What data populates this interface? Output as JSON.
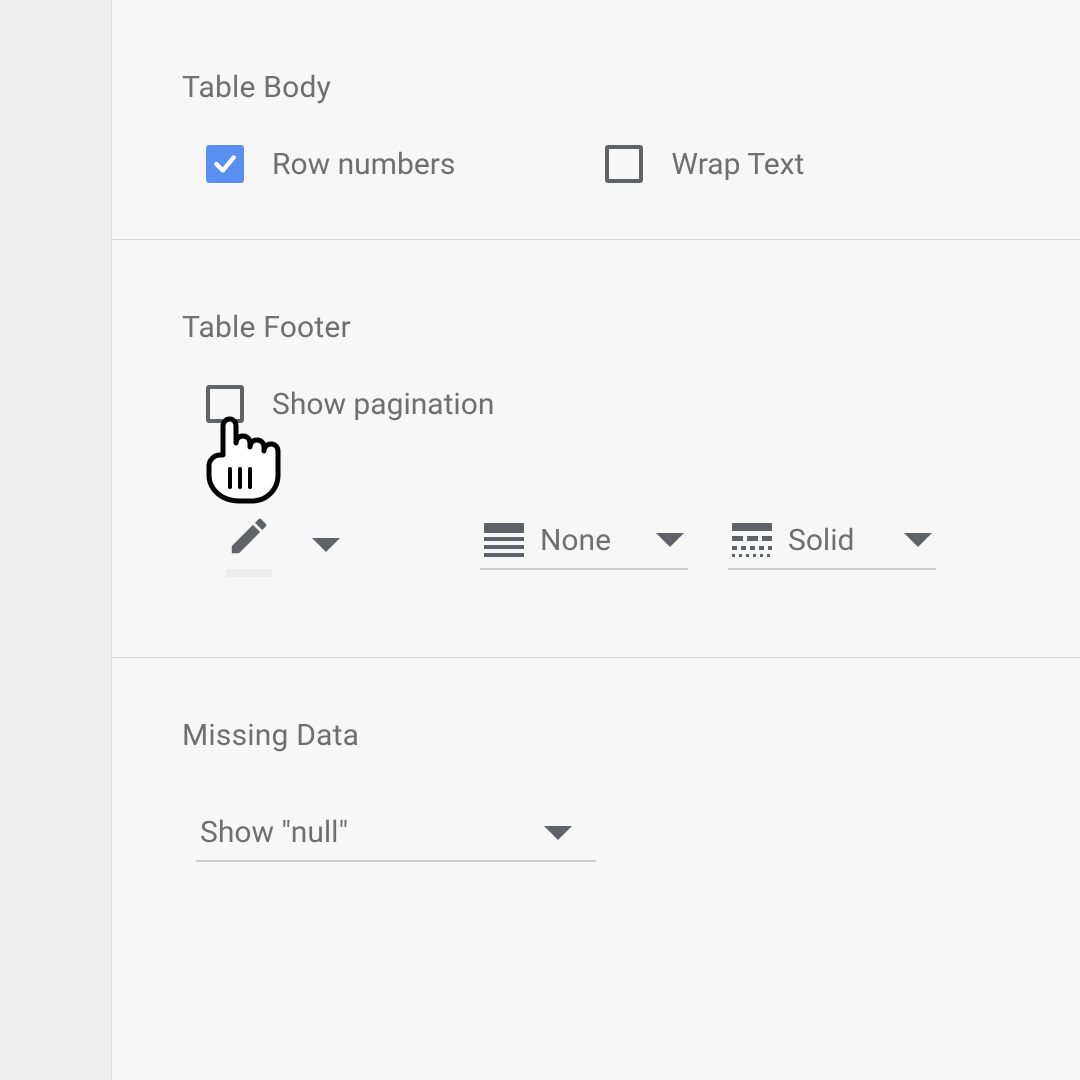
{
  "body": {
    "title": "Table Body",
    "row_numbers": {
      "label": "Row numbers",
      "checked": true
    },
    "wrap_text": {
      "label": "Wrap Text",
      "checked": false
    }
  },
  "footer": {
    "title": "Table Footer",
    "show_pagination": {
      "label": "Show pagination",
      "checked": false
    },
    "line_style_1": "None",
    "line_style_2": "Solid"
  },
  "missing": {
    "title": "Missing Data",
    "option": "Show \"null\""
  }
}
